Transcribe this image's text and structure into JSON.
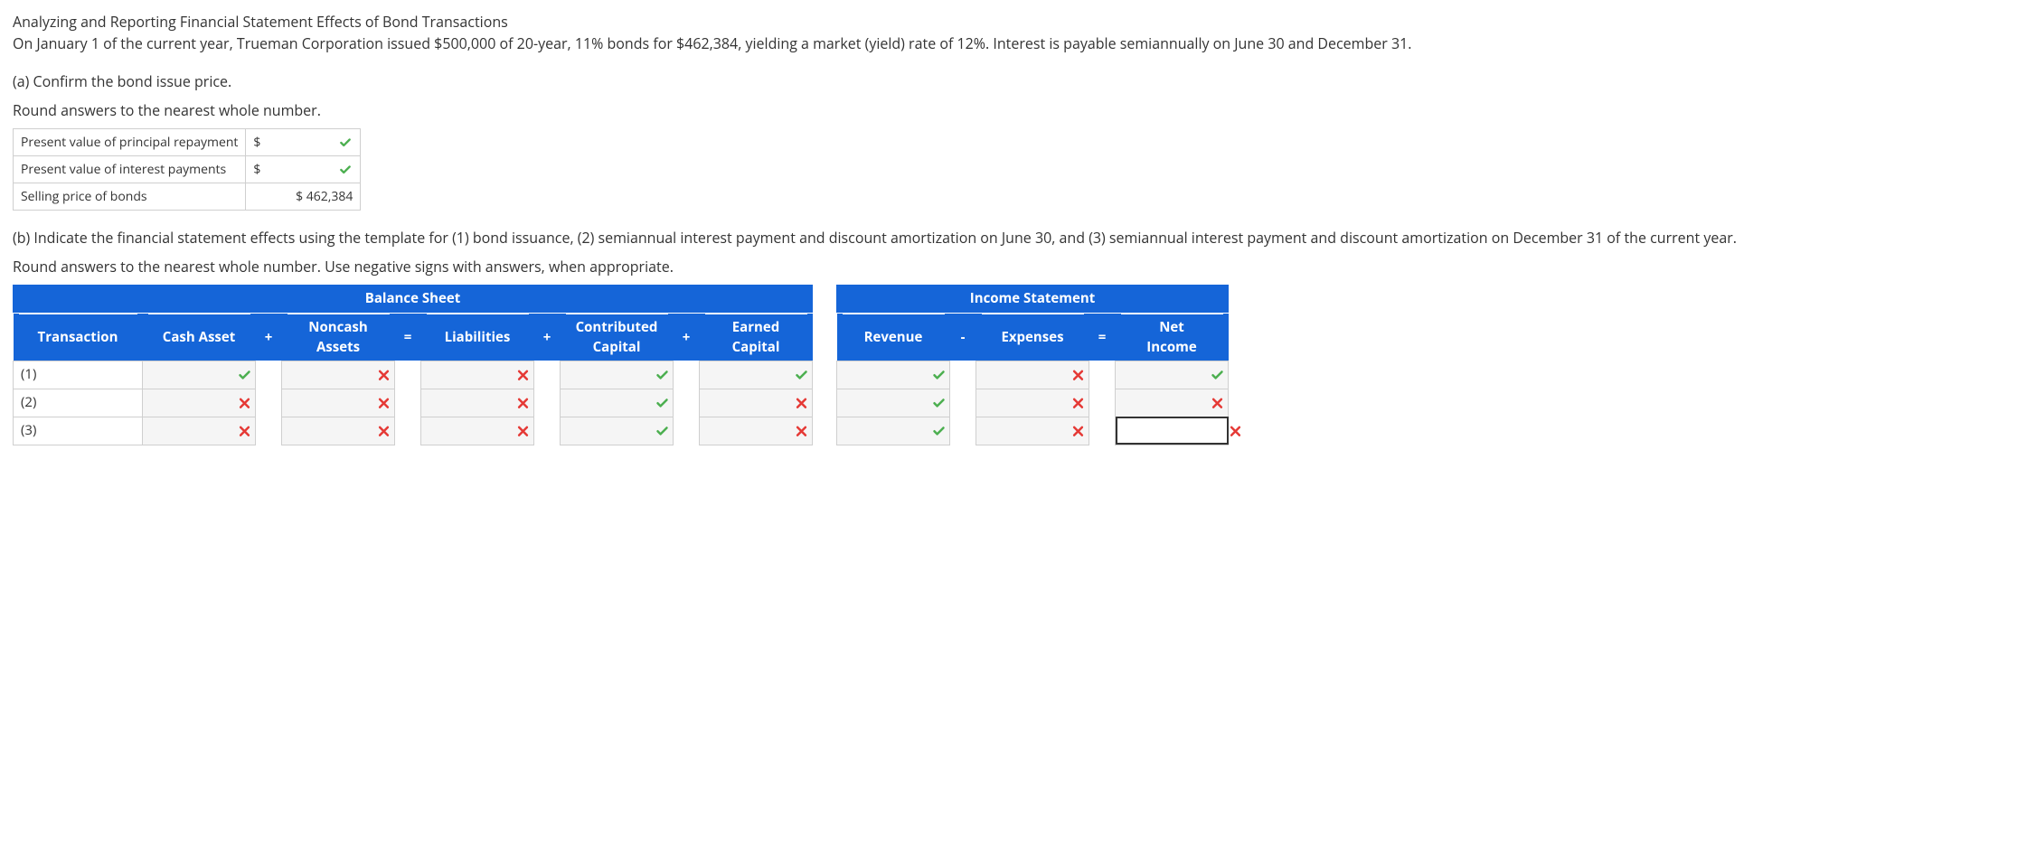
{
  "title": "Analyzing and Reporting Financial Statement Effects of Bond Transactions",
  "intro": "On January 1 of the current year, Trueman Corporation issued $500,000 of 20-year, 11% bonds for $462,384, yielding a market (yield) rate of 12%. Interest is payable semiannually on June 30 and December 31.",
  "part_a": {
    "prompt": "(a) Confirm the bond issue price.",
    "round_note": "Round answers to the nearest whole number.",
    "rows": [
      {
        "label": "Present value of principal repayment",
        "prefix": "$",
        "value": "",
        "status": "ok"
      },
      {
        "label": "Present value of interest payments",
        "prefix": "$",
        "value": "",
        "status": "ok"
      },
      {
        "label": "Selling price of bonds",
        "prefix": "",
        "value": "$ 462,384",
        "status": ""
      }
    ]
  },
  "part_b": {
    "prompt": "(b) Indicate the financial statement effects using the template for (1) bond issuance, (2) semiannual interest payment and discount amortization on June 30, and (3) semiannual interest payment and discount amortization on December 31 of the current year.",
    "round_note": "Round answers to the nearest whole number. Use negative signs with answers, when appropriate."
  },
  "fs_template": {
    "bs_title": "Balance Sheet",
    "is_title": "Income Statement",
    "headers": {
      "txn": "Transaction",
      "cash": "Cash Asset",
      "noncash": "Noncash\nAssets",
      "liab": "Liabilities",
      "ccap": "Contributed\nCapital",
      "ecap": "Earned\nCapital",
      "rev": "Revenue",
      "exp": "Expenses",
      "ni": "Net\nIncome"
    },
    "ops": {
      "plus": "+",
      "eq": "=",
      "minus": "-"
    },
    "rows": [
      {
        "txn": "(1)",
        "bs": [
          "ok",
          "bad",
          "bad",
          "ok",
          "ok"
        ],
        "is": [
          "ok",
          "bad",
          "ok"
        ],
        "focus_is": null
      },
      {
        "txn": "(2)",
        "bs": [
          "bad",
          "bad",
          "bad",
          "ok",
          "bad"
        ],
        "is": [
          "ok",
          "bad",
          "bad"
        ],
        "focus_is": null
      },
      {
        "txn": "(3)",
        "bs": [
          "bad",
          "bad",
          "bad",
          "ok",
          "bad"
        ],
        "is": [
          "ok",
          "bad",
          "bad"
        ],
        "focus_is": 2
      }
    ]
  }
}
